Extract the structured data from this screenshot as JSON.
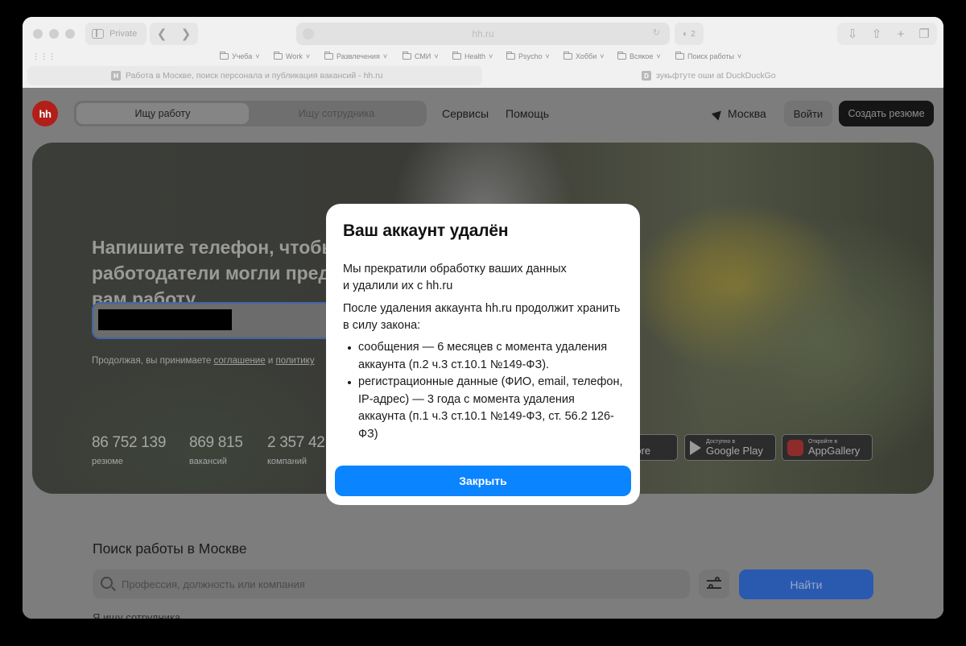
{
  "browser": {
    "private_label": "Private",
    "url": "hh.ru",
    "extension_badge": "2",
    "bookmarks": [
      "Учеба",
      "Work",
      "Развлечения",
      "СМИ",
      "Health",
      "Psycho",
      "Хобби",
      "Всякое",
      "Поиск работы"
    ],
    "tabs": [
      {
        "favicon": "H",
        "title": "Работа в Москве, поиск персонала и публикация вакансий - hh.ru"
      },
      {
        "favicon": "D",
        "title": "зукьфтуте оши at DuckDuckGo"
      }
    ]
  },
  "header": {
    "logo": "hh",
    "segment_active": "Ищу работу",
    "segment_inactive": "Ищу сотрудника",
    "services": "Сервисы",
    "help": "Помощь",
    "city": "Москва",
    "login": "Войти",
    "create_resume": "Создать резюме"
  },
  "hero": {
    "title": "Напишите телефон, чтобы работодатели могли предложить вам работу",
    "consent_prefix": "Продолжая, вы принимаете ",
    "consent_agreement": "соглашение",
    "consent_and": " и ",
    "consent_policy": "политику",
    "stats": [
      {
        "value": "86 752 139",
        "label": "резюме"
      },
      {
        "value": "869 815",
        "label": "вакансий"
      },
      {
        "value": "2 357 42",
        "label": "компаний"
      }
    ],
    "stores": [
      {
        "small": "e в",
        "big": "Store"
      },
      {
        "small": "Доступно в",
        "big": "Google Play"
      },
      {
        "small": "Откройте в",
        "big": "AppGallery"
      }
    ]
  },
  "search": {
    "title": "Поиск работы в Москве",
    "placeholder": "Профессия, должность или компания",
    "find": "Найти",
    "employer_link": "Я ищу сотрудника"
  },
  "modal": {
    "title": "Ваш аккаунт удалён",
    "p1_line1": "Мы прекратили обработку ваших данных",
    "p1_line2": "и удалили их с hh.ru",
    "p2": "После удаления аккаунта hh.ru продолжит хранить в силу закона:",
    "bullets": [
      "сообщения — 6 месяцев с момента удаления аккаунта (п.2 ч.3 ст.10.1 №149-ФЗ).",
      "регистрационные данные (ФИО, email, телефон, IP-адрес) — 3 года с момента удаления аккаунта (п.1 ч.3 ст.10.1 №149-ФЗ, ст. 56.2 126-ФЗ)"
    ],
    "close": "Закрыть"
  }
}
